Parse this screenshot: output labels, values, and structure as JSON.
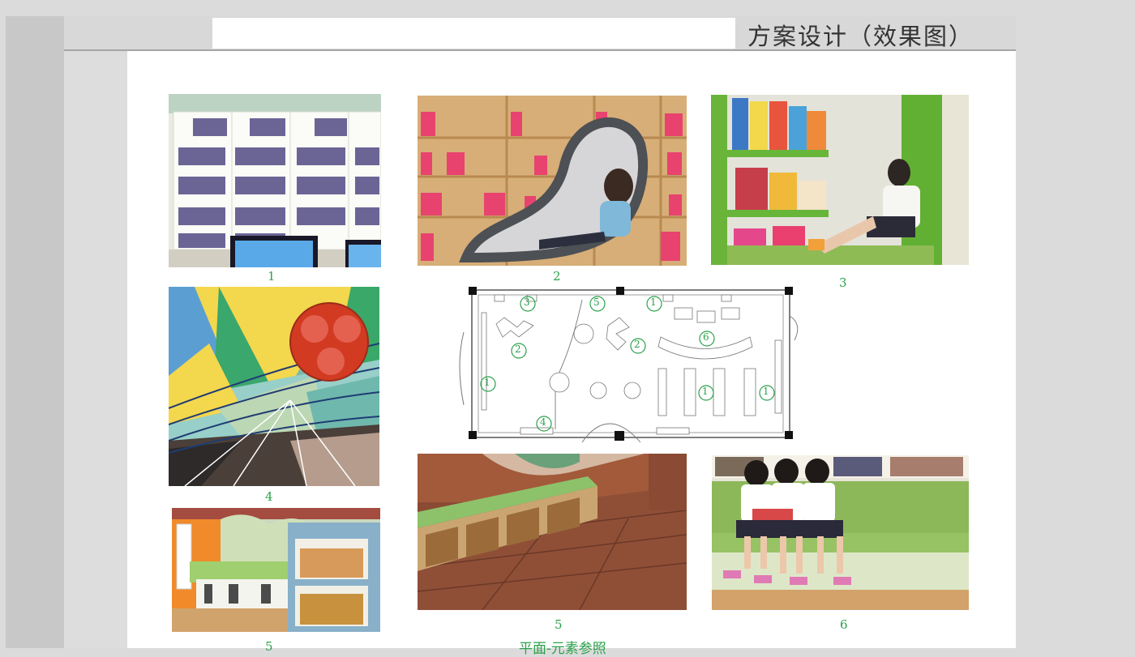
{
  "header": {
    "title": "方案设计（效果图）"
  },
  "captions": {
    "c1": "1",
    "c2": "2",
    "c3": "3",
    "c4": "4",
    "c5a": "5",
    "c5b": "5",
    "c6": "6"
  },
  "plan": {
    "markers": [
      "3",
      "5",
      "1",
      "2",
      "2",
      "6",
      "1",
      "1",
      "1",
      "4"
    ],
    "footer": "平面-元素参照"
  },
  "colors": {
    "accent": "#2aa14a",
    "green": "#6ab43a",
    "pink": "#e8426f"
  }
}
